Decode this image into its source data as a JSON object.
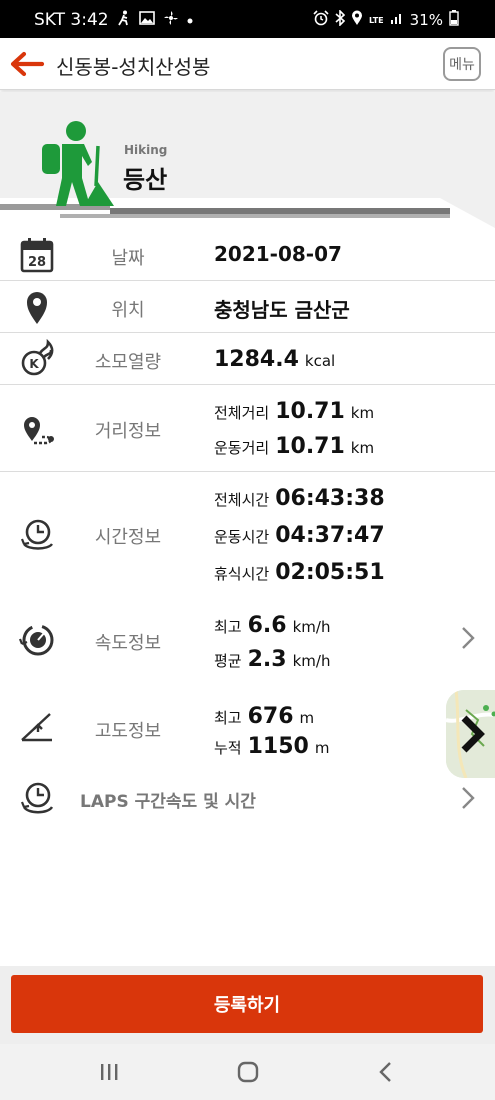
{
  "status_bar": {
    "carrier_time": "SKT 3:42",
    "battery": "31%",
    "network": "LTE",
    "left_icons": [
      "walk-notify-icon",
      "gallery-icon",
      "fan-icon",
      "dot-icon"
    ],
    "right_icons": [
      "alarm-icon",
      "bluetooth-icon",
      "location-icon",
      "lte-icon",
      "signal-icon",
      "battery-icon"
    ]
  },
  "header": {
    "title": "신동봉-성치산성봉",
    "menu_label": "메뉴",
    "accent_color": "#d9360b"
  },
  "activity": {
    "english": "Hiking",
    "korean": "등산",
    "icon_color": "#1e9a3a"
  },
  "rows": {
    "date": {
      "label": "날짜",
      "value": "2021-08-07",
      "icon_text": "28"
    },
    "location": {
      "label": "위치",
      "value": "충청남도 금산군"
    },
    "calories": {
      "label": "소모열량",
      "value": "1284.4",
      "unit": "kcal",
      "icon_text": "K"
    },
    "distance": {
      "label": "거리정보",
      "items": [
        {
          "key": "전체거리",
          "value": "10.71",
          "unit": "km"
        },
        {
          "key": "운동거리",
          "value": "10.71",
          "unit": "km"
        }
      ]
    },
    "time": {
      "label": "시간정보",
      "items": [
        {
          "key": "전체시간",
          "value": "06:43:38"
        },
        {
          "key": "운동시간",
          "value": "04:37:47"
        },
        {
          "key": "휴식시간",
          "value": "02:05:51"
        }
      ]
    },
    "speed": {
      "label": "속도정보",
      "items": [
        {
          "key": "최고",
          "value": "6.6",
          "unit": "km/h"
        },
        {
          "key": "평균",
          "value": "2.3",
          "unit": "km/h"
        }
      ]
    },
    "altitude": {
      "label": "고도정보",
      "items": [
        {
          "key": "최고",
          "value": "676",
          "unit": "m"
        },
        {
          "key": "누적",
          "value": "1150",
          "unit": "m"
        }
      ]
    },
    "laps": {
      "label": "LAPS 구간속도 및 시간"
    }
  },
  "register_button": "등록하기"
}
